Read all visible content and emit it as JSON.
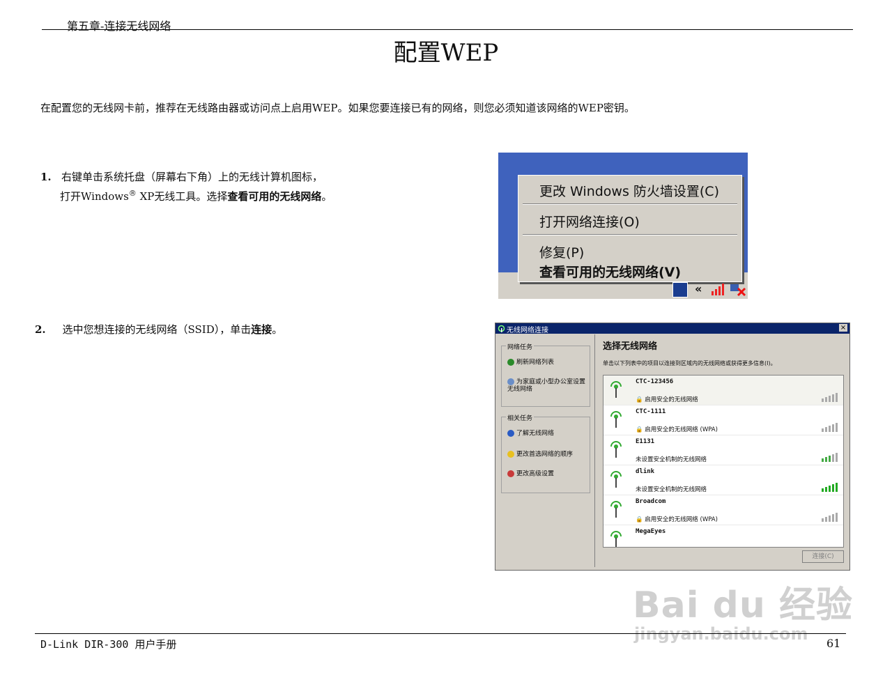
{
  "header": {
    "chapter": "第五章-连接无线网络"
  },
  "title": "配置WEP",
  "intro": "在配置您的无线网卡前，推荐在无线路由器或访问点上启用WEP。如果您要连接已有的网络，则您必须知道该网络的WEP密钥。",
  "step1": {
    "num": "1.",
    "line1": "右键单击系统托盘（屏幕右下角）上的无线计算机图标，",
    "line2a": "打开Windows",
    "reg": "®",
    "line2b": " XP无线工具。选择",
    "bold": "查看可用的无线网络",
    "end": "。"
  },
  "step2": {
    "num": "2.",
    "text": "选中您想连接的无线网络（SSID），单击",
    "bold": "连接",
    "end": "。"
  },
  "context_menu": {
    "items": [
      "更改 Windows 防火墙设置(C)",
      "打开网络连接(O)",
      "修复(P)",
      "查看可用的无线网络(V)"
    ],
    "tray_chevron": "«"
  },
  "dialog": {
    "title": "无线网络连接",
    "close": "×",
    "network_tasks": {
      "title": "网络任务",
      "items": [
        "刷新网络列表",
        "为家庭或小型办公室设置无线网络"
      ]
    },
    "related_tasks": {
      "title": "相关任务",
      "items": [
        "了解无线网络",
        "更改首选网络的顺序",
        "更改高级设置"
      ]
    },
    "heading": "选择无线网络",
    "description": "单击以下列表中的项目以连接到区域内的无线网络或获得更多信息(I)。",
    "networks": [
      {
        "name": "CTC-123456",
        "status": "启用安全的无线网络"
      },
      {
        "name": "CTC-1111",
        "status": "启用安全的无线网络 (WPA)"
      },
      {
        "name": "E1131",
        "status": "未设置安全机制的无线网络"
      },
      {
        "name": "dlink",
        "status": "未设置安全机制的无线网络"
      },
      {
        "name": "Broadcom",
        "status": "启用安全的无线网络 (WPA)"
      },
      {
        "name": "MegaEyes",
        "status": ""
      }
    ],
    "connect_button": "连接(C)"
  },
  "footer": {
    "manual": "D-Link DIR-300 用户手册",
    "page": "61"
  },
  "watermark": {
    "brand": "Bai du 经验",
    "url": "jingyan.baidu.com"
  }
}
